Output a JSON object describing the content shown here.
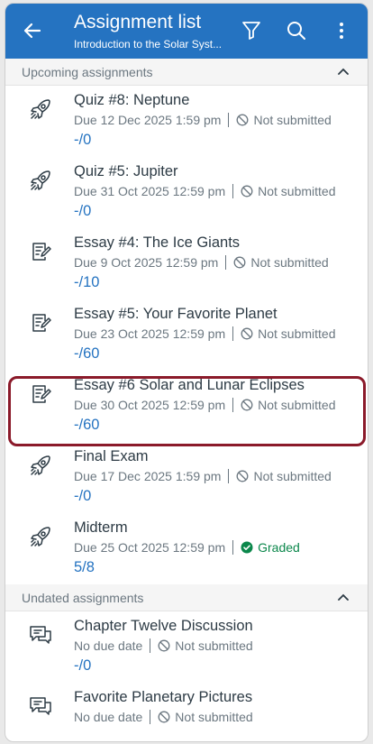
{
  "header": {
    "title": "Assignment list",
    "subtitle": "Introduction to the Solar Syst...",
    "icons": [
      "back-arrow-icon",
      "filter-icon",
      "search-icon",
      "more-vertical-icon"
    ]
  },
  "sections": [
    {
      "title": "Upcoming assignments",
      "items": [
        {
          "icon": "rocket-icon",
          "name": "Quiz #8: Neptune",
          "due": "Due 12 Dec 2025 1:59 pm",
          "status": "Not submitted",
          "score": "-/0"
        },
        {
          "icon": "rocket-icon",
          "name": "Quiz #5: Jupiter",
          "due": "Due 31 Oct 2025 12:59 pm",
          "status": "Not submitted",
          "score": "-/0"
        },
        {
          "icon": "assignment-icon",
          "name": "Essay #4: The Ice Giants",
          "due": "Due 9 Oct 2025 12:59 pm",
          "status": "Not submitted",
          "score": "-/10"
        },
        {
          "icon": "assignment-icon",
          "name": "Essay #5: Your Favorite Planet",
          "due": "Due 23 Oct 2025 12:59 pm",
          "status": "Not submitted",
          "score": "-/60"
        },
        {
          "icon": "assignment-icon",
          "name": "Essay #6 Solar and Lunar Eclipses",
          "due": "Due 30 Oct 2025 12:59 pm",
          "status": "Not submitted",
          "score": "-/60"
        },
        {
          "icon": "rocket-icon",
          "name": "Final Exam",
          "due": "Due 17 Dec 2025 1:59 pm",
          "status": "Not submitted",
          "score": "-/0"
        },
        {
          "icon": "rocket-icon",
          "name": "Midterm",
          "due": "Due 25 Oct 2025 12:59 pm",
          "status": "Graded",
          "score": "5/8"
        }
      ]
    },
    {
      "title": "Undated assignments",
      "items": [
        {
          "icon": "discussion-icon",
          "name": "Chapter Twelve Discussion",
          "due": "No due date",
          "status": "Not submitted",
          "score": "-/0"
        },
        {
          "icon": "discussion-icon",
          "name": "Favorite Planetary Pictures",
          "due": "No due date",
          "status": "Not submitted",
          "score": ""
        }
      ]
    }
  ],
  "colors": {
    "brand": "#2573c1",
    "text": "#2d3b45",
    "muted": "#6b7780",
    "graded": "#0b874b",
    "highlight": "#8b1a2a"
  }
}
